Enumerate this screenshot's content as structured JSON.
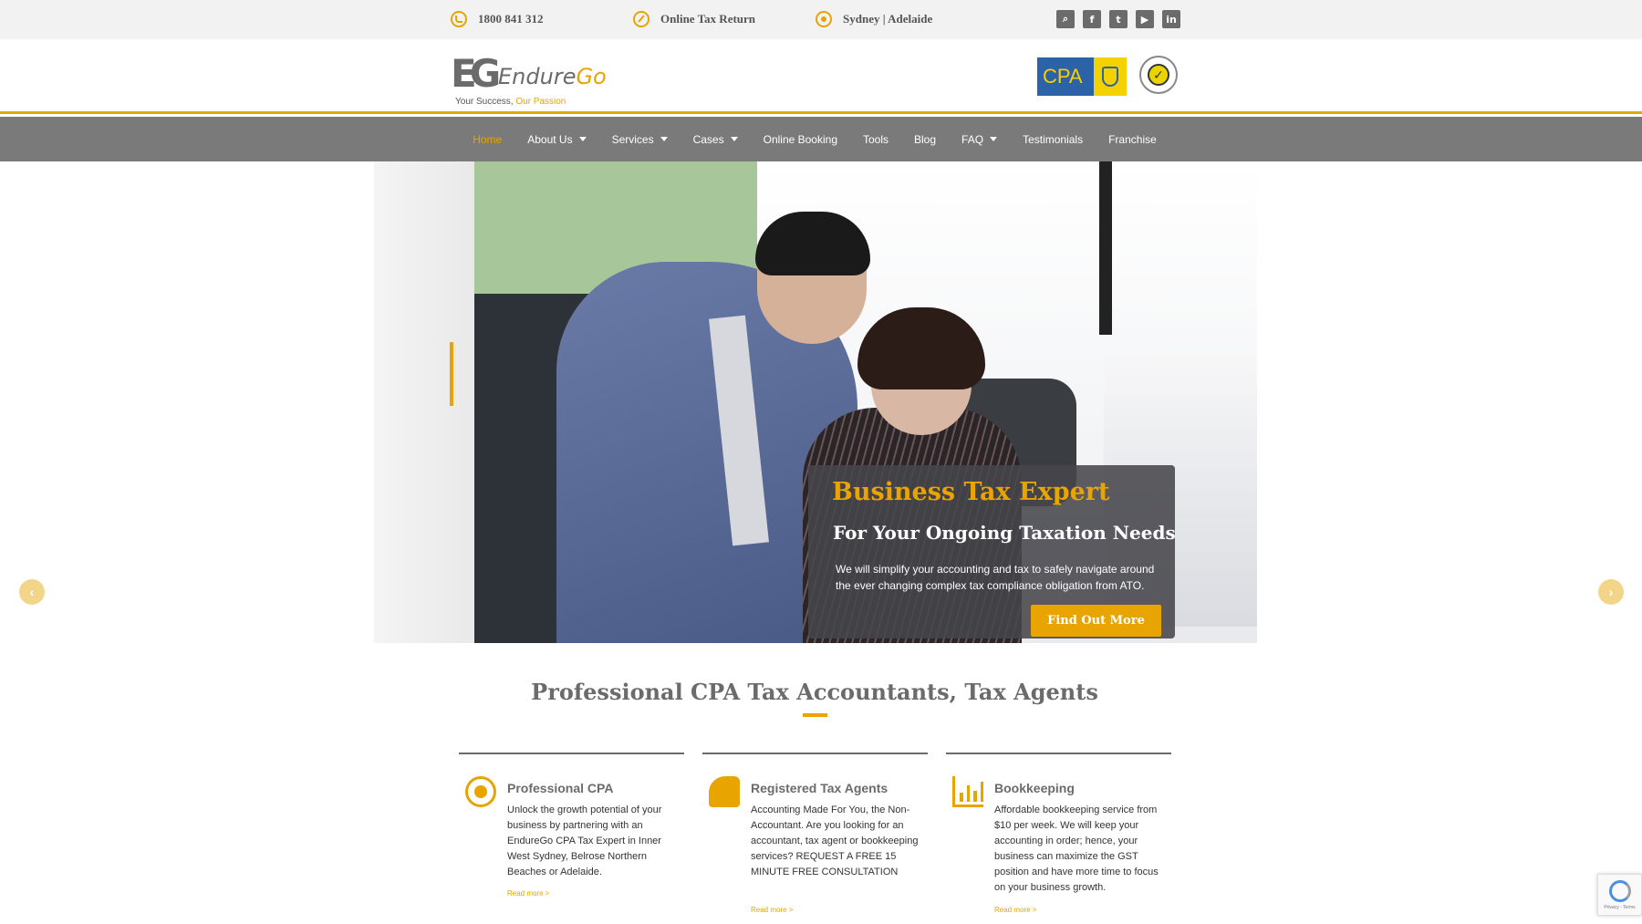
{
  "topbar": {
    "phone": "1800 841 312",
    "online_tax": "Online Tax Return",
    "locations": "Sydney | Adelaide",
    "social": [
      "search-icon",
      "facebook-icon",
      "twitter-icon",
      "youtube-icon",
      "linkedin-icon"
    ]
  },
  "header": {
    "logo_letters": "EG",
    "logo_brand_1": "Endure",
    "logo_brand_2": "Go",
    "tagline_1": "Your Success, ",
    "tagline_2": "Our Passion",
    "cpa_text": "CPA"
  },
  "nav": {
    "items": [
      {
        "label": "Home",
        "active": true
      },
      {
        "label": "About Us",
        "dropdown": true
      },
      {
        "label": "Services",
        "dropdown": true
      },
      {
        "label": "Cases",
        "dropdown": true
      },
      {
        "label": "Online Booking"
      },
      {
        "label": "Tools"
      },
      {
        "label": "Blog"
      },
      {
        "label": "FAQ",
        "dropdown": true
      },
      {
        "label": "Testimonials"
      },
      {
        "label": "Franchise"
      }
    ]
  },
  "hero": {
    "title": "Business Tax Expert",
    "subtitle": "For Your Ongoing Taxation Needs",
    "text": "We will simplify your accounting and tax to safely navigate around the ever changing complex tax compliance obligation from ATO.",
    "button": "Find Out More",
    "prev": "‹",
    "next": "›"
  },
  "section": {
    "title": "Professional CPA Tax Accountants, Tax Agents"
  },
  "features": [
    {
      "icon": "target-icon",
      "title": "Professional CPA",
      "desc": "Unlock the growth potential of your business by partnering with an EndureGo CPA Tax Expert in Inner West Sydney, Belrose Northern Beaches or Adelaide.",
      "more": "Read more >"
    },
    {
      "icon": "knight-icon",
      "title": "Registered Tax Agents",
      "desc": "Accounting Made For You, the Non-Accountant. Are you looking for an accountant, tax agent or bookkeeping services? REQUEST A FREE 15 MINUTE FREE CONSULTATION",
      "more": "Read more >"
    },
    {
      "icon": "bar-chart-icon",
      "title": "Bookkeeping",
      "desc": "Affordable bookkeeping service from $10 per week. We will keep your accounting in order; hence, your business can maximize the GST position and have more time to focus on your business growth.",
      "more": "Read more >"
    }
  ],
  "recaptcha": {
    "text": "Privacy - Terms"
  },
  "colors": {
    "accent": "#e8a400",
    "nav_bg": "#7a7a7a",
    "text_dark": "#6b6b6b"
  }
}
